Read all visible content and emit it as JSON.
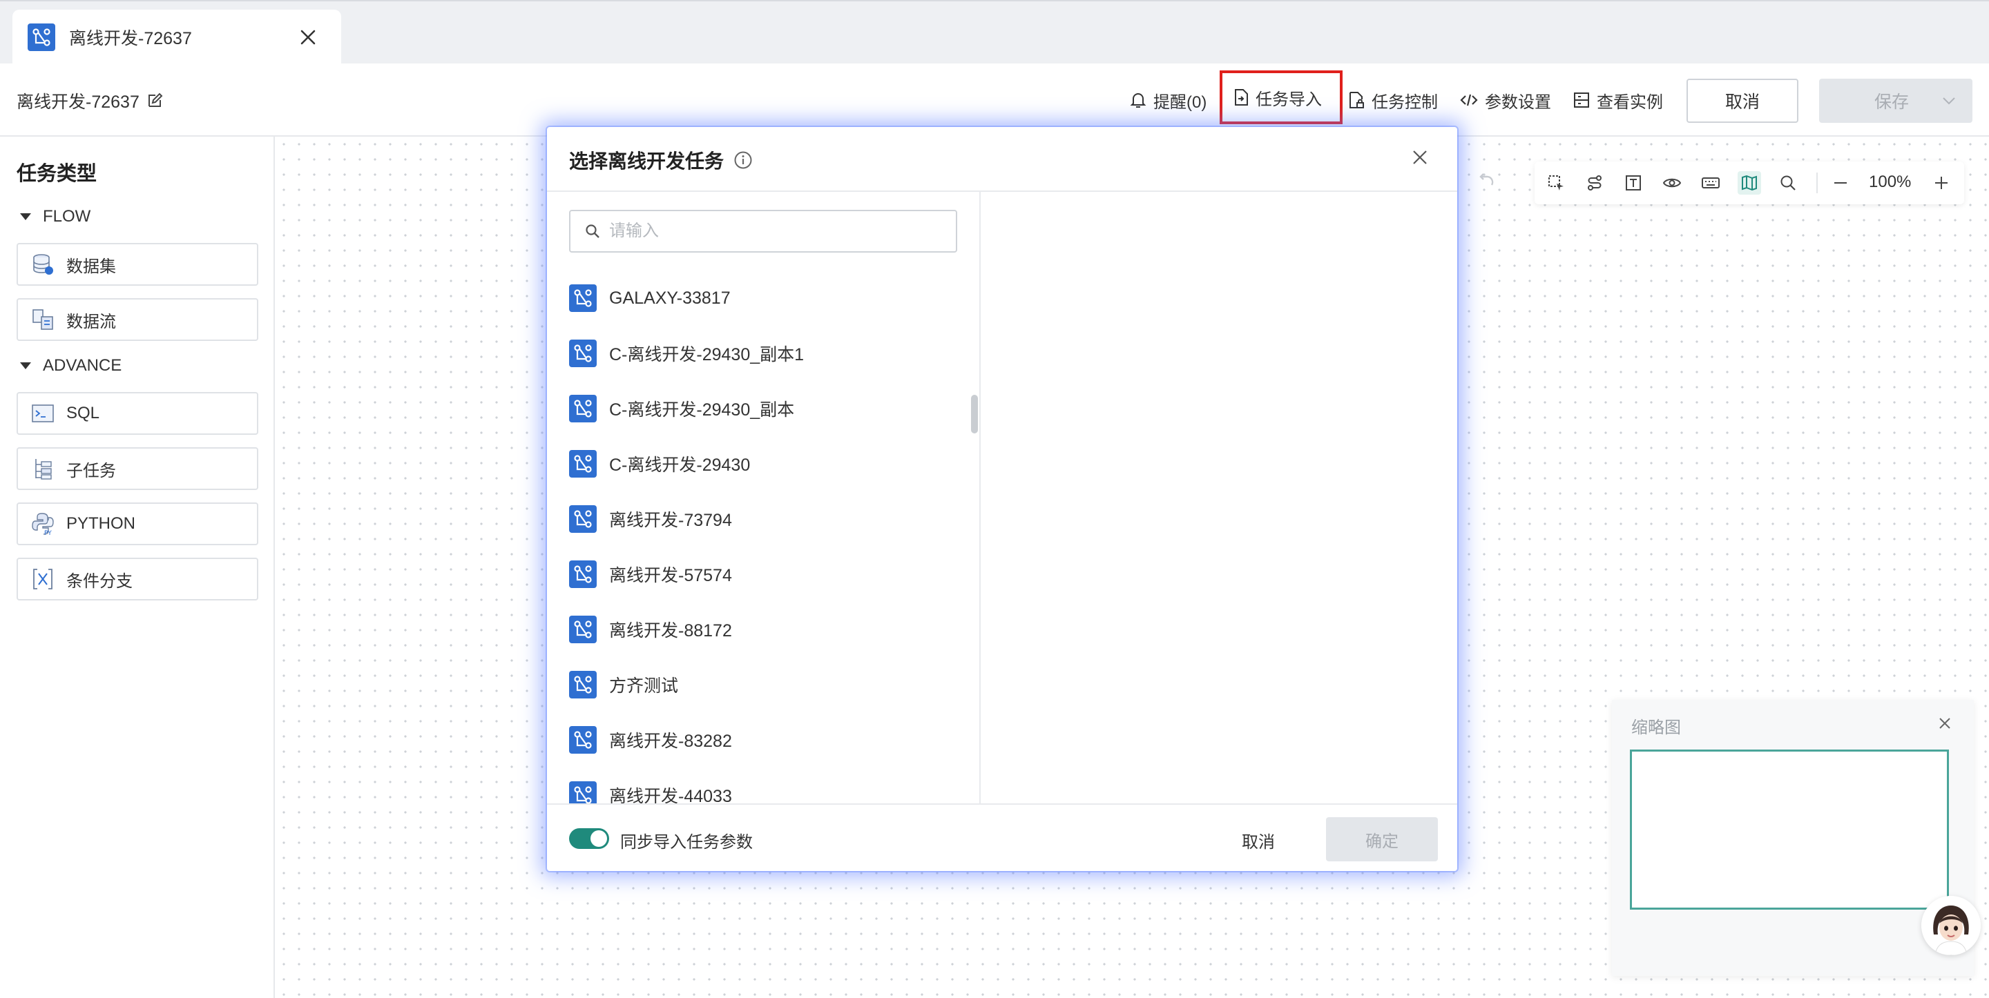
{
  "tab": {
    "title": "离线开发-72637"
  },
  "header": {
    "doc_title": "离线开发-72637",
    "remind": "提醒(0)",
    "task_import": "任务导入",
    "task_control": "任务控制",
    "param_settings": "参数设置",
    "view_instance": "查看实例",
    "cancel": "取消",
    "save": "保存"
  },
  "sidebar": {
    "title": "任务类型",
    "groups": [
      {
        "name": "FLOW",
        "items": [
          "数据集",
          "数据流"
        ]
      },
      {
        "name": "ADVANCE",
        "items": [
          "SQL",
          "子任务",
          "PYTHON",
          "条件分支"
        ]
      }
    ]
  },
  "canvas": {
    "zoom": "100%"
  },
  "minimap": {
    "title": "缩略图"
  },
  "modal": {
    "title": "选择离线开发任务",
    "search_placeholder": "请输入",
    "items": [
      "GALAXY-33817",
      "C-离线开发-29430_副本1",
      "C-离线开发-29430_副本",
      "C-离线开发-29430",
      "离线开发-73794",
      "离线开发-57574",
      "离线开发-88172",
      "方齐测试",
      "离线开发-83282",
      "离线开发-44033"
    ],
    "toggle_label": "同步导入任务参数",
    "toggle_on": true,
    "cancel": "取消",
    "ok": "确定"
  },
  "colors": {
    "accent": "#1f8a7c",
    "icon_blue": "#2f6fd1",
    "highlight_red": "#e0201c"
  }
}
